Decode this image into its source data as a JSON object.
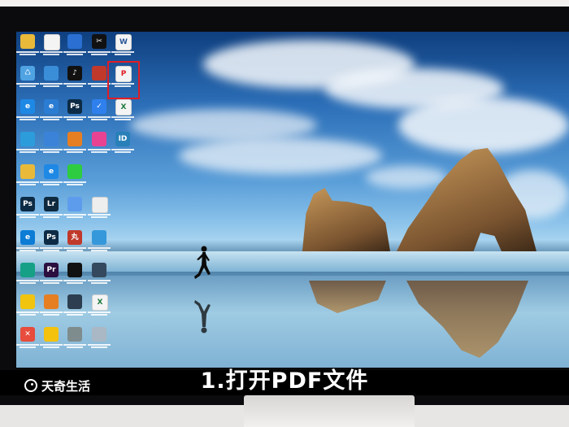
{
  "caption": "1.打开PDF文件",
  "watermark": {
    "brand_text": "天奇生活"
  },
  "highlight_color": "#e01c24",
  "desktop": {
    "wallpaper": "Windows 10 beach wallpaper with rocks and runner",
    "icons": [
      {
        "id": "folder-1",
        "glyph": "",
        "color": "#e9b93a"
      },
      {
        "id": "doc-1",
        "glyph": "",
        "color": "#f4f4f4"
      },
      {
        "id": "control-panel",
        "glyph": "",
        "color": "#2a6fd1"
      },
      {
        "id": "capcut",
        "glyph": "✂",
        "color": "#111111"
      },
      {
        "id": "word-doc",
        "glyph": "W",
        "color": "#f4f4f4"
      },
      {
        "id": "recycle-bin",
        "glyph": "♺",
        "color": "#4fa3e3"
      },
      {
        "id": "network",
        "glyph": "",
        "color": "#3a8ed8"
      },
      {
        "id": "tiktok",
        "glyph": "♪",
        "color": "#111111"
      },
      {
        "id": "app-red",
        "glyph": "",
        "color": "#c0392b"
      },
      {
        "id": "pdf-file",
        "glyph": "P",
        "color": "#f4f4f4"
      },
      {
        "id": "edge-1",
        "glyph": "e",
        "color": "#1e88e5"
      },
      {
        "id": "ie",
        "glyph": "e",
        "color": "#2b7cd3"
      },
      {
        "id": "photoshop",
        "glyph": "Ps",
        "color": "#0d2b45"
      },
      {
        "id": "security",
        "glyph": "✓",
        "color": "#2f80ed"
      },
      {
        "id": "excel-doc",
        "glyph": "X",
        "color": "#f4f4f4"
      },
      {
        "id": "qq-music",
        "glyph": "",
        "color": "#2d9cdb"
      },
      {
        "id": "app-blue",
        "glyph": "",
        "color": "#3b83d9"
      },
      {
        "id": "app-orange",
        "glyph": "",
        "color": "#e67e22"
      },
      {
        "id": "colorful-app",
        "glyph": "",
        "color": "#e84393"
      },
      {
        "id": "app-id",
        "glyph": "ID",
        "color": "#2980b9"
      },
      {
        "id": "folder-2",
        "glyph": "",
        "color": "#e9b93a"
      },
      {
        "id": "edge-2",
        "glyph": "e",
        "color": "#1e88e5"
      },
      {
        "id": "wechat",
        "glyph": "",
        "color": "#2ecc40"
      },
      {
        "id": "photoshop-2",
        "glyph": "Ps",
        "color": "#0d2b45"
      },
      {
        "id": "lightroom",
        "glyph": "Lr",
        "color": "#0f2a3f"
      },
      {
        "id": "app-game",
        "glyph": "",
        "color": "#5d9cec"
      },
      {
        "id": "text-doc",
        "glyph": "",
        "color": "#eeeeee"
      },
      {
        "id": "edge-3",
        "glyph": "e",
        "color": "#0c7cd5"
      },
      {
        "id": "photoshop-3",
        "glyph": "Ps",
        "color": "#0d2b45"
      },
      {
        "id": "app-red-2",
        "glyph": "丸",
        "color": "#c0392b"
      },
      {
        "id": "app-doc-blue",
        "glyph": "",
        "color": "#3498db"
      },
      {
        "id": "app-teal",
        "glyph": "",
        "color": "#16a085"
      },
      {
        "id": "premiere",
        "glyph": "Pr",
        "color": "#2a0f3f"
      },
      {
        "id": "qq",
        "glyph": "",
        "color": "#111111"
      },
      {
        "id": "app-gear",
        "glyph": "",
        "color": "#34495e"
      },
      {
        "id": "app-yellow",
        "glyph": "",
        "color": "#f1c40f"
      },
      {
        "id": "app-orange-2",
        "glyph": "",
        "color": "#e67e22"
      },
      {
        "id": "monitor-app",
        "glyph": "",
        "color": "#2c3e50"
      },
      {
        "id": "excel-doc-2",
        "glyph": "X",
        "color": "#f4f4f4"
      },
      {
        "id": "app-x",
        "glyph": "✕",
        "color": "#e74c3c"
      },
      {
        "id": "chrome",
        "glyph": "",
        "color": "#f4c20d"
      },
      {
        "id": "app-photo",
        "glyph": "",
        "color": "#7f8c8d"
      },
      {
        "id": "app-snow",
        "glyph": "",
        "color": "#aab7c4"
      }
    ]
  }
}
